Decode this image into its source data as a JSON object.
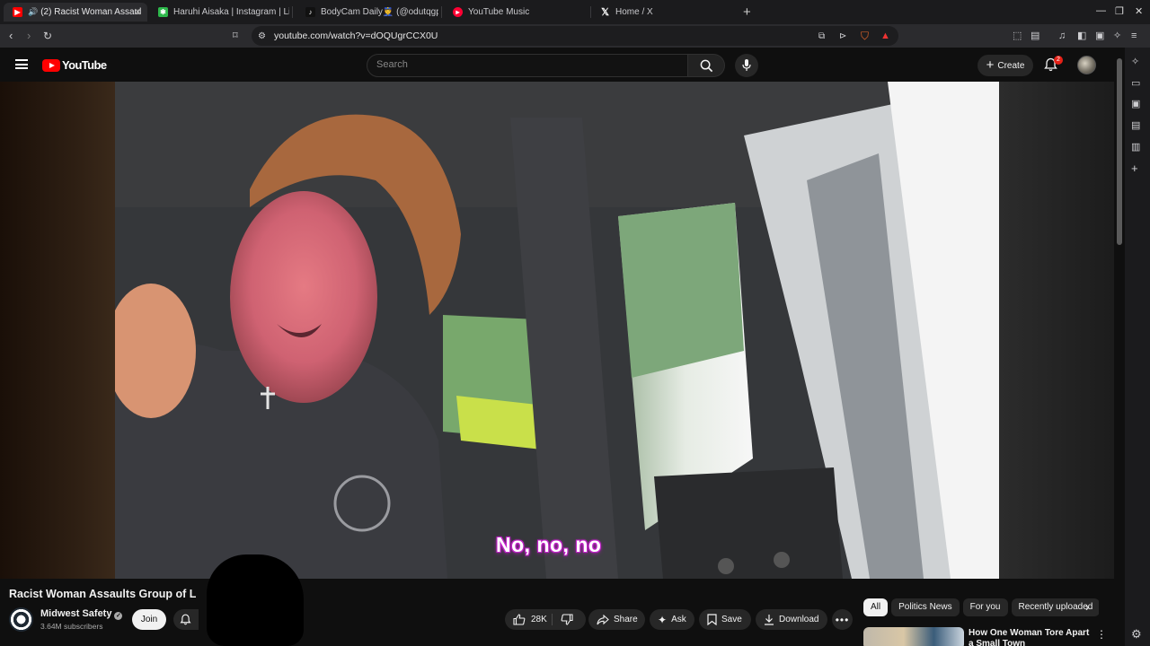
{
  "browser": {
    "tabs": [
      {
        "title": "(2) Racist Woman Assaults Group of L",
        "favicon_color": "#ff0000",
        "active": true
      },
      {
        "title": "Haruhi Aisaka | Instagram | Lin",
        "favicon_color": "#2db84b",
        "active": false
      },
      {
        "title": "BodyCam Daily👮 (@odutqgp71",
        "favicon_color": "#111111",
        "active": false
      },
      {
        "title": "YouTube Music",
        "favicon_color": "#ff0033",
        "active": false
      },
      {
        "title": "Home / X",
        "favicon_color": "#000000",
        "active": false
      }
    ],
    "url": "youtube.com/watch?v=dOQUgrCCX0U"
  },
  "masthead": {
    "logo_text": "YouTube",
    "search_placeholder": "Search",
    "create_label": "Create",
    "notification_count": "2"
  },
  "player": {
    "subtitle": "No, no, no"
  },
  "video": {
    "title": "Racist Woman Assaults Group of L",
    "channel_name": "Midwest Safety",
    "subscribers": "3.64M subscribers",
    "join_label": "Join",
    "like_count": "28K",
    "share_label": "Share",
    "ask_label": "Ask",
    "save_label": "Save",
    "download_label": "Download"
  },
  "recommendations": {
    "chips": [
      "All",
      "Politics News",
      "For you",
      "Recently uploaded"
    ],
    "first_item_title": "How One Woman Tore Apart a Small Town"
  },
  "colors": {
    "accent_red": "#ff0000",
    "background": "#0f0f0f",
    "subtitle_outline": "#c222c9"
  }
}
